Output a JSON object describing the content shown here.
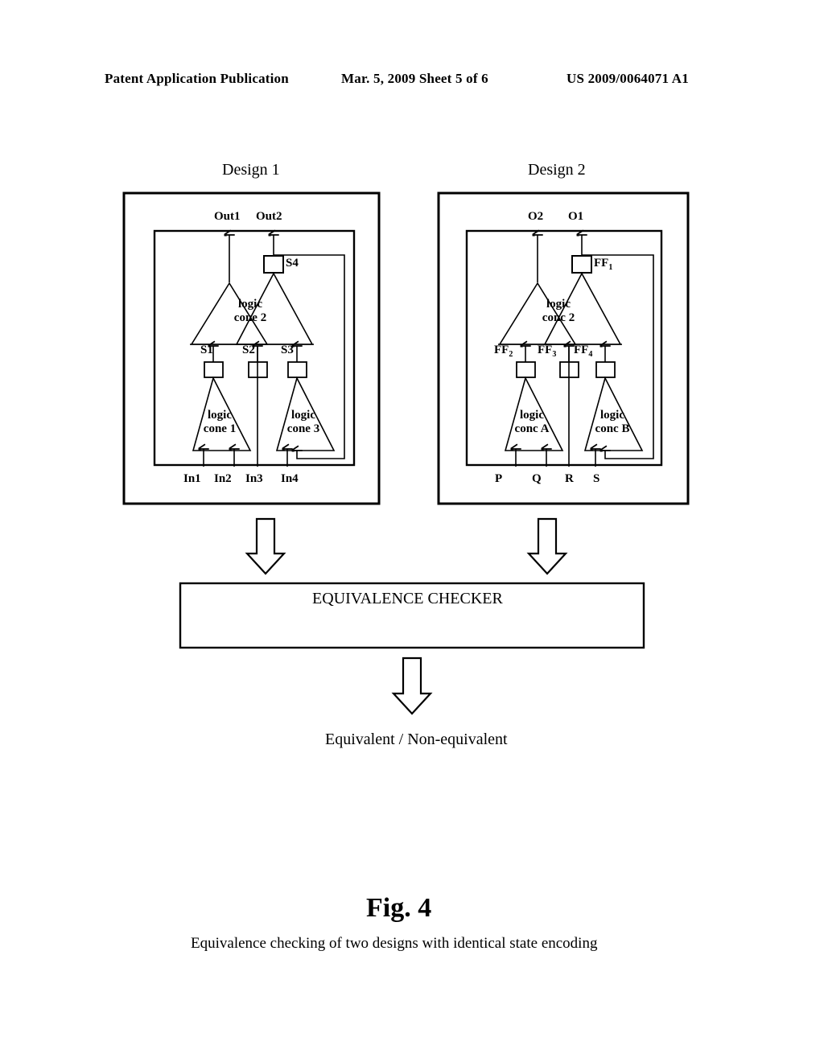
{
  "header": {
    "publication": "Patent Application Publication",
    "date_sheet": "Mar. 5, 2009  Sheet 5 of 6",
    "patent_number": "US 2009/0064071 A1"
  },
  "figure": {
    "number_label": "Fig. 4",
    "caption": "Equivalence checking of two designs with identical state encoding"
  },
  "design1": {
    "title": "Design 1",
    "outputs": [
      "Out1",
      "Out2"
    ],
    "inputs": [
      "In1",
      "In2",
      "In3",
      "In4"
    ],
    "registers": {
      "top": "S4",
      "middle": [
        "S1",
        "S2",
        "S3"
      ]
    },
    "cones": [
      {
        "line1": "logic",
        "line2": "cone 1"
      },
      {
        "line1": "logic",
        "line2": "cone 2"
      },
      {
        "line1": "logic",
        "line2": "cone 3"
      }
    ]
  },
  "design2": {
    "title": "Design 2",
    "outputs": [
      "O2",
      "O1"
    ],
    "inputs": [
      "P",
      "Q",
      "R",
      "S"
    ],
    "registers": {
      "top": {
        "base": "FF",
        "sub": "1"
      },
      "middle": [
        {
          "base": "FF",
          "sub": "2"
        },
        {
          "base": "FF",
          "sub": "3"
        },
        {
          "base": "FF",
          "sub": "4"
        }
      ]
    },
    "cones": [
      {
        "line1": "logic",
        "line2": "conc A"
      },
      {
        "line1": "logic",
        "line2": "conc 2"
      },
      {
        "line1": "logic",
        "line2": "conc B"
      }
    ]
  },
  "checker": {
    "label": "EQUIVALENCE CHECKER"
  },
  "result": {
    "label": "Equivalent / Non-equivalent"
  },
  "colors": {
    "ink": "#000000",
    "paper": "#ffffff"
  }
}
